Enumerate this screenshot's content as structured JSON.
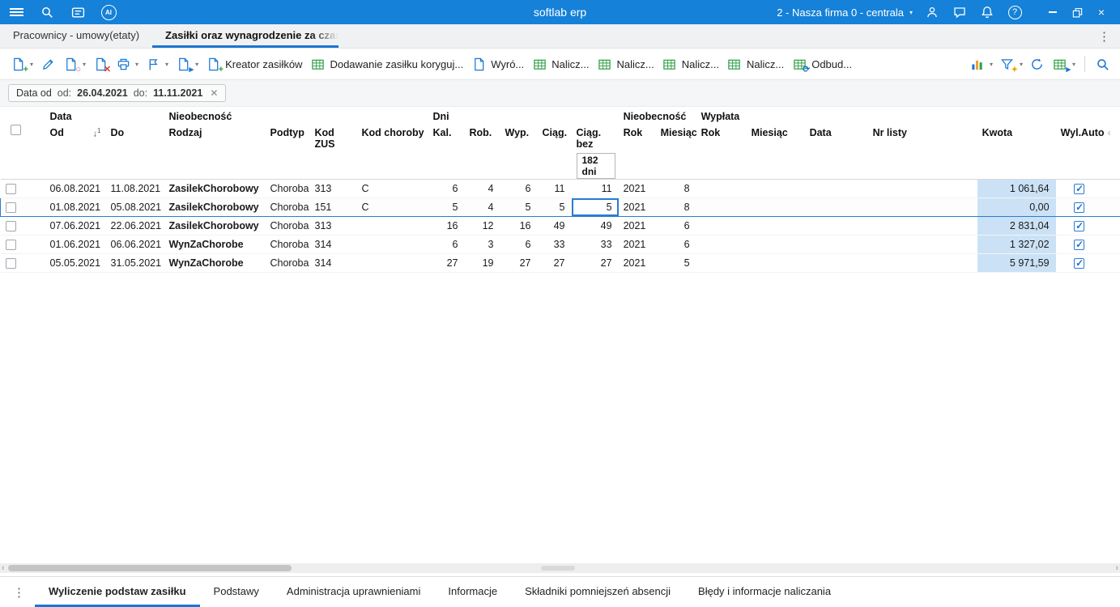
{
  "titlebar": {
    "app_title": "softlab erp",
    "company": "2 - Nasza firma 0 - centrala",
    "ai_badge": "AI"
  },
  "tabstrip": {
    "tabs": [
      {
        "label": "Pracownicy - umowy(etaty)",
        "active": false
      },
      {
        "label": "Zasiłki oraz wynagrodzenie za czas cho",
        "active": true
      }
    ]
  },
  "toolbar": {
    "kreator_label": "Kreator zasiłków",
    "dodawanie_label": "Dodawanie zasiłku koryguj...",
    "wyroz_label": "Wyró...",
    "nalicz_labels": [
      "Nalicz...",
      "Nalicz...",
      "Nalicz...",
      "Nalicz..."
    ],
    "odbud_label": "Odbud..."
  },
  "filterbar": {
    "chip_name": "Data od",
    "od_label": "od:",
    "od_value": "26.04.2021",
    "do_label": "do:",
    "do_value": "11.11.2021"
  },
  "table": {
    "groups": {
      "data": "Data",
      "nieobecnosc": "Nieobecność",
      "dni": "Dni",
      "nieobecnosc2": "Nieobecność",
      "wyplata": "Wypłata"
    },
    "headers": {
      "od": "Od",
      "do": "Do",
      "rodzaj": "Rodzaj",
      "podtyp": "Podtyp",
      "kod_zus": "Kod ZUS",
      "kod_choroby": "Kod choroby",
      "kal": "Kal.",
      "rob": "Rob.",
      "wyp": "Wyp.",
      "ciag": "Ciąg.",
      "ciag_bez_1": "Ciąg. bez",
      "ciag_bez_2": "182 dni",
      "rok": "Rok",
      "miesiac": "Miesiąc",
      "rok2": "Rok",
      "miesiac2": "Miesiąc",
      "data": "Data",
      "nr_listy": "Nr listy",
      "kwota": "Kwota",
      "wyl_auto": "Wyl.Auto"
    },
    "sort_order": "1",
    "rows": [
      {
        "od": "06.08.2021",
        "do": "11.08.2021",
        "rodzaj": "ZasilekChorobowy",
        "podtyp": "Choroba",
        "kod_zus": "313",
        "kod_choroby": "C",
        "kal": "6",
        "rob": "4",
        "wyp": "6",
        "ciag": "11",
        "ciag_bez": "11",
        "nieob_rok": "2021",
        "nieob_miesiac": "8",
        "wyp_rok": "",
        "wyp_miesiac": "",
        "wyp_data": "",
        "nr_listy": "",
        "kwota": "1 061,64",
        "wyl_auto": true,
        "selected": false
      },
      {
        "od": "01.08.2021",
        "do": "05.08.2021",
        "rodzaj": "ZasilekChorobowy",
        "podtyp": "Choroba",
        "kod_zus": "151",
        "kod_choroby": "C",
        "kal": "5",
        "rob": "4",
        "wyp": "5",
        "ciag": "5",
        "ciag_bez": "5",
        "nieob_rok": "2021",
        "nieob_miesiac": "8",
        "wyp_rok": "",
        "wyp_miesiac": "",
        "wyp_data": "",
        "nr_listy": "",
        "kwota": "0,00",
        "wyl_auto": true,
        "selected": true,
        "selected_cell": "ciag_bez"
      },
      {
        "od": "07.06.2021",
        "do": "22.06.2021",
        "rodzaj": "ZasilekChorobowy",
        "podtyp": "Choroba",
        "kod_zus": "313",
        "kod_choroby": "",
        "kal": "16",
        "rob": "12",
        "wyp": "16",
        "ciag": "49",
        "ciag_bez": "49",
        "nieob_rok": "2021",
        "nieob_miesiac": "6",
        "wyp_rok": "",
        "wyp_miesiac": "",
        "wyp_data": "",
        "nr_listy": "",
        "kwota": "2 831,04",
        "wyl_auto": true,
        "selected": false
      },
      {
        "od": "01.06.2021",
        "do": "06.06.2021",
        "rodzaj": "WynZaChorobe",
        "podtyp": "Choroba",
        "kod_zus": "314",
        "kod_choroby": "",
        "kal": "6",
        "rob": "3",
        "wyp": "6",
        "ciag": "33",
        "ciag_bez": "33",
        "nieob_rok": "2021",
        "nieob_miesiac": "6",
        "wyp_rok": "",
        "wyp_miesiac": "",
        "wyp_data": "",
        "nr_listy": "",
        "kwota": "1 327,02",
        "wyl_auto": true,
        "selected": false
      },
      {
        "od": "05.05.2021",
        "do": "31.05.2021",
        "rodzaj": "WynZaChorobe",
        "podtyp": "Choroba",
        "kod_zus": "314",
        "kod_choroby": "",
        "kal": "27",
        "rob": "19",
        "wyp": "27",
        "ciag": "27",
        "ciag_bez": "27",
        "nieob_rok": "2021",
        "nieob_miesiac": "5",
        "wyp_rok": "",
        "wyp_miesiac": "",
        "wyp_data": "",
        "nr_listy": "",
        "kwota": "5 971,59",
        "wyl_auto": true,
        "selected": false
      }
    ]
  },
  "bottom_tabs": [
    {
      "label": "Wyliczenie podstaw zasiłku",
      "active": true
    },
    {
      "label": "Podstawy",
      "active": false
    },
    {
      "label": "Administracja uprawnieniami",
      "active": false
    },
    {
      "label": "Informacje",
      "active": false
    },
    {
      "label": "Składniki pomniejszeń absencji",
      "active": false
    },
    {
      "label": "Błędy i informacje naliczania",
      "active": false
    }
  ]
}
